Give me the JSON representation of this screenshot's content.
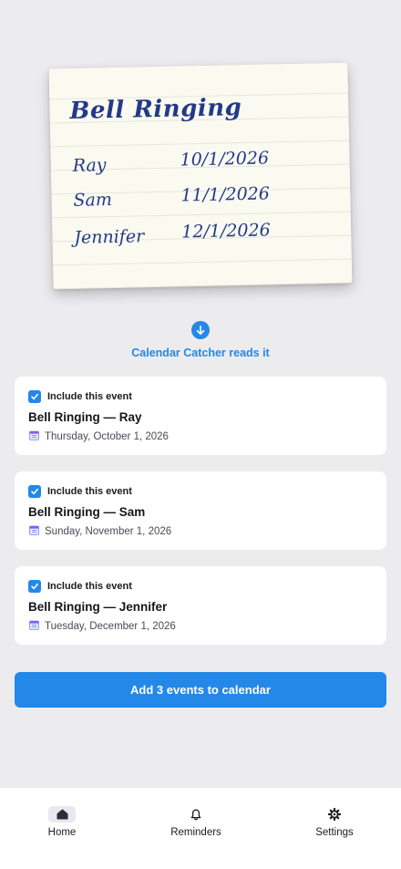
{
  "note": {
    "title": "Bell Ringing",
    "rows": [
      {
        "name": "Ray",
        "date": "10/1/2026"
      },
      {
        "name": "Sam",
        "date": "11/1/2026"
      },
      {
        "name": "Jennifer",
        "date": "12/1/2026"
      }
    ]
  },
  "reads_caption": "Calendar Catcher reads it",
  "events": [
    {
      "include_label": "Include this event",
      "checked": true,
      "title": "Bell Ringing — Ray",
      "date": "Thursday, October 1, 2026"
    },
    {
      "include_label": "Include this event",
      "checked": true,
      "title": "Bell Ringing — Sam",
      "date": "Sunday, November 1, 2026"
    },
    {
      "include_label": "Include this event",
      "checked": true,
      "title": "Bell Ringing — Jennifer",
      "date": "Tuesday, December 1, 2026"
    }
  ],
  "cta_label": "Add 3 events to calendar",
  "tabs": [
    {
      "label": "Home",
      "icon": "home-icon",
      "active": true
    },
    {
      "label": "Reminders",
      "icon": "bell-icon",
      "active": false
    },
    {
      "label": "Settings",
      "icon": "gear-icon",
      "active": false
    }
  ],
  "colors": {
    "accent": "#2388e8",
    "background": "#ececef",
    "ink": "#233a86"
  }
}
